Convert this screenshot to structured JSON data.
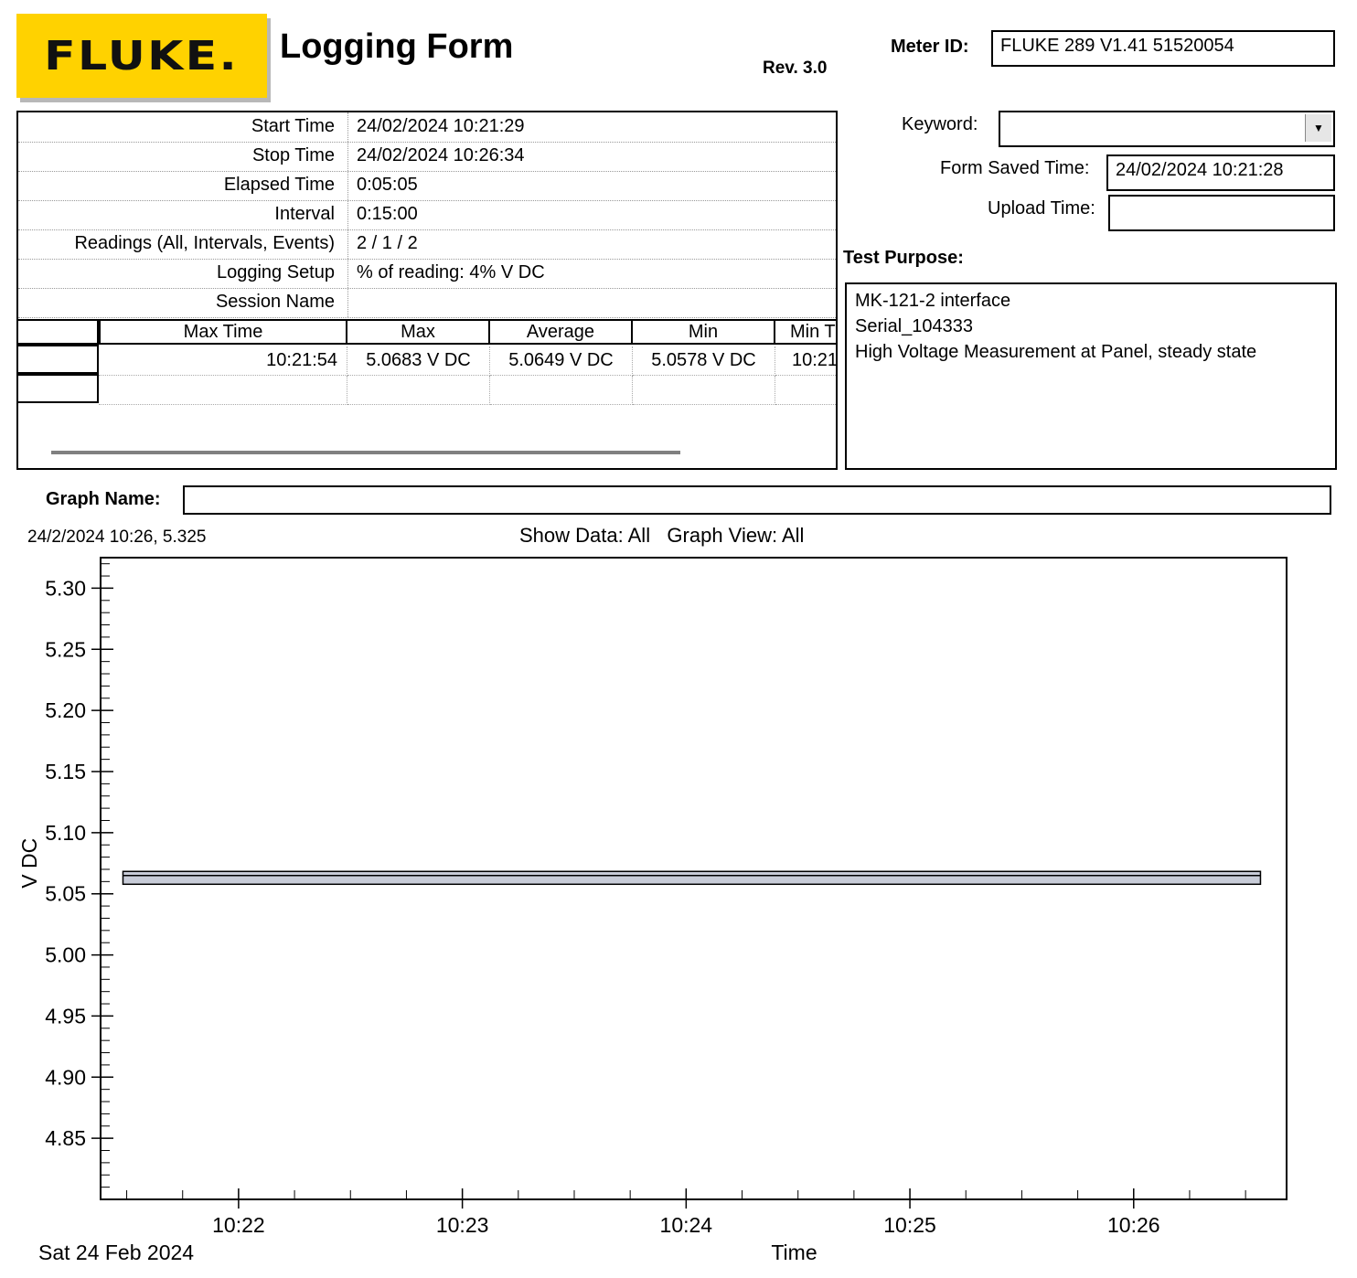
{
  "header": {
    "logo_text": "FLUKE.",
    "title": "Logging Form",
    "revision": "Rev. 3.0",
    "meter_id_label": "Meter ID:",
    "meter_id_value": "FLUKE 289  V1.41  51520054",
    "keyword_label": "Keyword:",
    "keyword_value": "",
    "form_saved_label": "Form Saved Time:",
    "form_saved_value": "24/02/2024 10:21:28",
    "upload_label": "Upload Time:",
    "upload_value": "",
    "test_purpose_label": "Test Purpose:"
  },
  "info": [
    {
      "key": "Start Time",
      "value": "24/02/2024 10:21:29"
    },
    {
      "key": "Stop Time",
      "value": "24/02/2024 10:26:34"
    },
    {
      "key": "Elapsed Time",
      "value": "0:05:05"
    },
    {
      "key": "Interval",
      "value": "0:15:00"
    },
    {
      "key": "Readings (All, Intervals, Events)",
      "value": "2 / 1 / 2"
    },
    {
      "key": "Logging Setup",
      "value": "% of reading: 4% V DC"
    },
    {
      "key": "Session Name",
      "value": ""
    }
  ],
  "stats_table": {
    "headers": [
      "Max Time",
      "Max",
      "Average",
      "Min",
      "Min T"
    ],
    "row": [
      "10:21:54",
      "5.0683 V DC",
      "5.0649 V DC",
      "5.0578 V DC",
      "10:21"
    ]
  },
  "test_purpose": [
    "MK-121-2 interface",
    "Serial_104333",
    "High Voltage Measurement at Panel, steady state"
  ],
  "graph": {
    "graph_name_label": "Graph Name:",
    "graph_name_value": "",
    "cursor_readout": "24/2/2024 10:26, 5.325",
    "show_data": "Show Data: All   Graph View: All",
    "date_label": "Sat 24 Feb 2024"
  },
  "colors": {
    "logo_yellow": "#ffd200",
    "band_fill": "#c8ccd8"
  },
  "chart_data": {
    "type": "area",
    "xlabel": "Time",
    "ylabel": "V DC",
    "x_ticks": [
      "10:22",
      "10:23",
      "10:24",
      "10:25",
      "10:26"
    ],
    "y_ticks": [
      "5.30",
      "5.25",
      "5.20",
      "5.15",
      "5.10",
      "5.05",
      "5.00",
      "4.95",
      "4.90",
      "4.85"
    ],
    "ylim": [
      4.8,
      5.325
    ],
    "xlim": [
      "10:21:23",
      "10:26:41"
    ],
    "series": [
      {
        "x": [
          "10:21:29",
          "10:26:34"
        ],
        "max": [
          5.0683,
          5.0683
        ],
        "average": [
          5.0649,
          5.0649
        ],
        "min": [
          5.0578,
          5.0578
        ]
      }
    ],
    "grid": false
  }
}
